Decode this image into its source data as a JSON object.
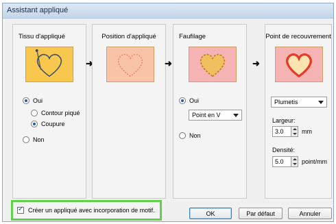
{
  "window": {
    "title": "Assistant appliqué"
  },
  "panels": [
    {
      "title": "Tissu d'appliqué",
      "image": "heart-needle-icon",
      "options": [
        {
          "label": "Oui",
          "selected": true
        },
        {
          "label": "Contour piqué",
          "selected": false
        },
        {
          "label": "Coupure",
          "selected": true
        },
        {
          "label": "Non",
          "selected": false
        }
      ]
    },
    {
      "title": "Position d'appliqué",
      "image": "heart-outline-icon"
    },
    {
      "title": "Faufilage",
      "image": "heart-running-stitch-icon",
      "options": [
        {
          "label": "Oui",
          "selected": true
        },
        {
          "label": "Non",
          "selected": false
        }
      ],
      "stitch": "Point en V"
    },
    {
      "title": "Point de recouvrement",
      "image": "heart-satin-icon",
      "stitch": "Plumetis",
      "width_label": "Largeur:",
      "width_value": "3.0",
      "width_unit": "mm",
      "density_label": "Densité:",
      "density_value": "5.0",
      "density_unit": "point/mm"
    }
  ],
  "checkbox": {
    "label": "Créer un appliqué avec incorporation de motif.",
    "checked": true
  },
  "buttons": {
    "ok": "OK",
    "default": "Par défaut",
    "cancel": "Annuler"
  },
  "colors": {
    "panel_orange": "#f7c74e",
    "panel_peach": "#f8c3a6",
    "panel_pink": "#f6b3b3",
    "highlight": "#61d14c"
  }
}
